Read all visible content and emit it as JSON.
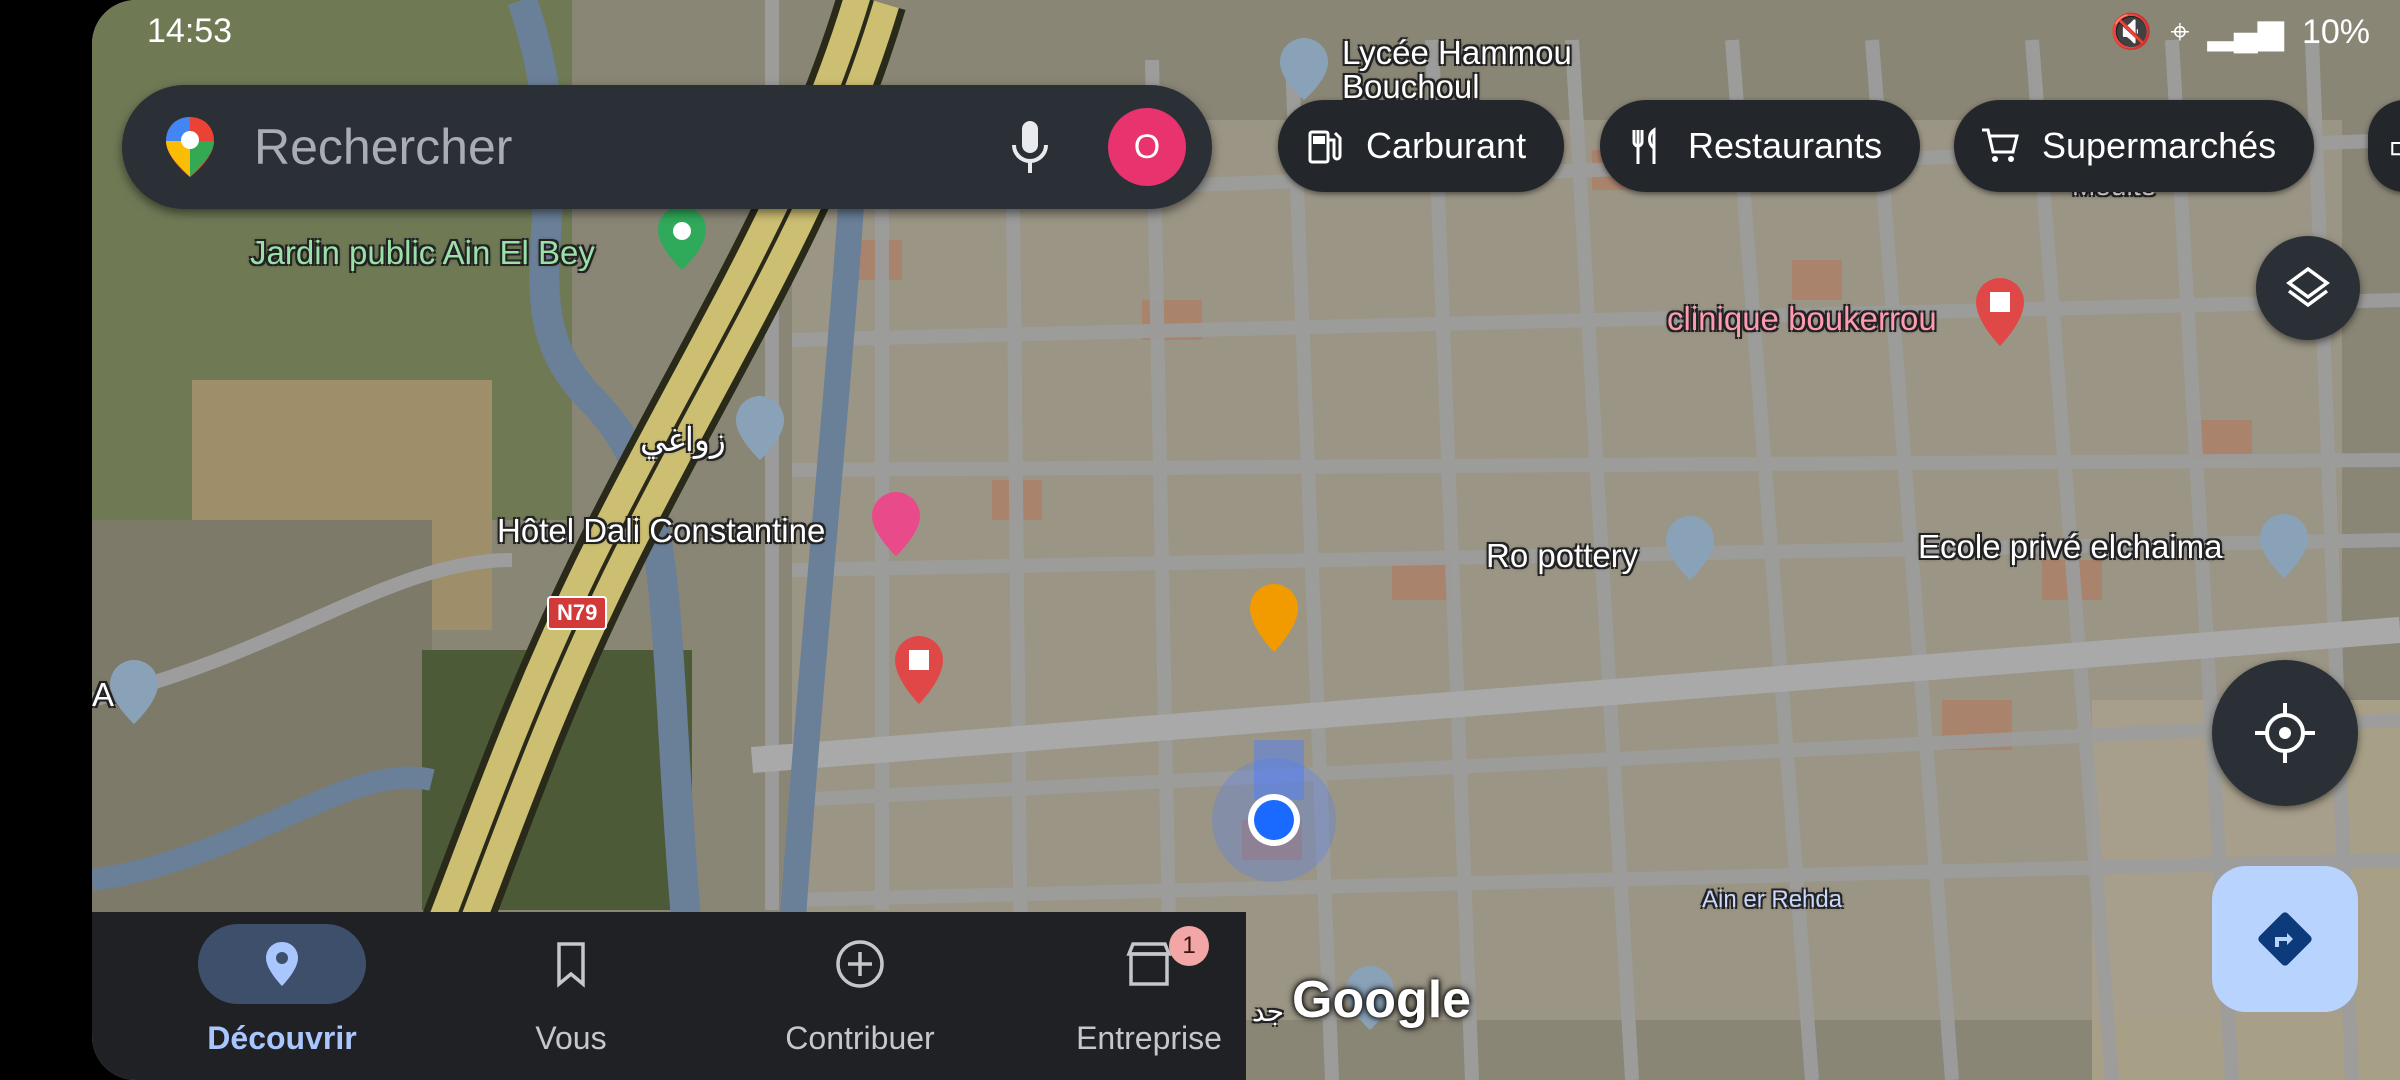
{
  "status_bar": {
    "time": "14:53",
    "battery": "10%"
  },
  "search": {
    "placeholder": "Rechercher",
    "avatar_letter": "O"
  },
  "chips": [
    {
      "label": "Carburant",
      "icon": "fuel-icon"
    },
    {
      "label": "Restaurants",
      "icon": "restaurant-icon"
    },
    {
      "label": "Supermarchés",
      "icon": "cart-icon"
    }
  ],
  "map": {
    "labels": {
      "lycee": "Lycée Hammou\nBouchoul",
      "jardin": "Jardin public Ain El Bey",
      "clinique": "clinique boukerrou",
      "zouaghi": "زواغي",
      "hotel": "Hôtel Dali Constantine",
      "pottery": "Ro pottery",
      "ecole": "Ecole privé elchaima",
      "ain": "Ain er Rehda",
      "road": "N79",
      "edge_a": "A",
      "moute": "Mouite",
      "masjid": "جد"
    },
    "watermark": "Google"
  },
  "nav": {
    "items": [
      {
        "label": "Découvrir",
        "active": true
      },
      {
        "label": "Vous",
        "active": false
      },
      {
        "label": "Contribuer",
        "active": false
      },
      {
        "label": "Entreprise",
        "active": false,
        "badge": "1"
      }
    ]
  },
  "colors": {
    "accent": "#a9c6ff",
    "avatar": "#e8336f",
    "pin_red": "#e04848",
    "pin_orange": "#f29b00"
  }
}
